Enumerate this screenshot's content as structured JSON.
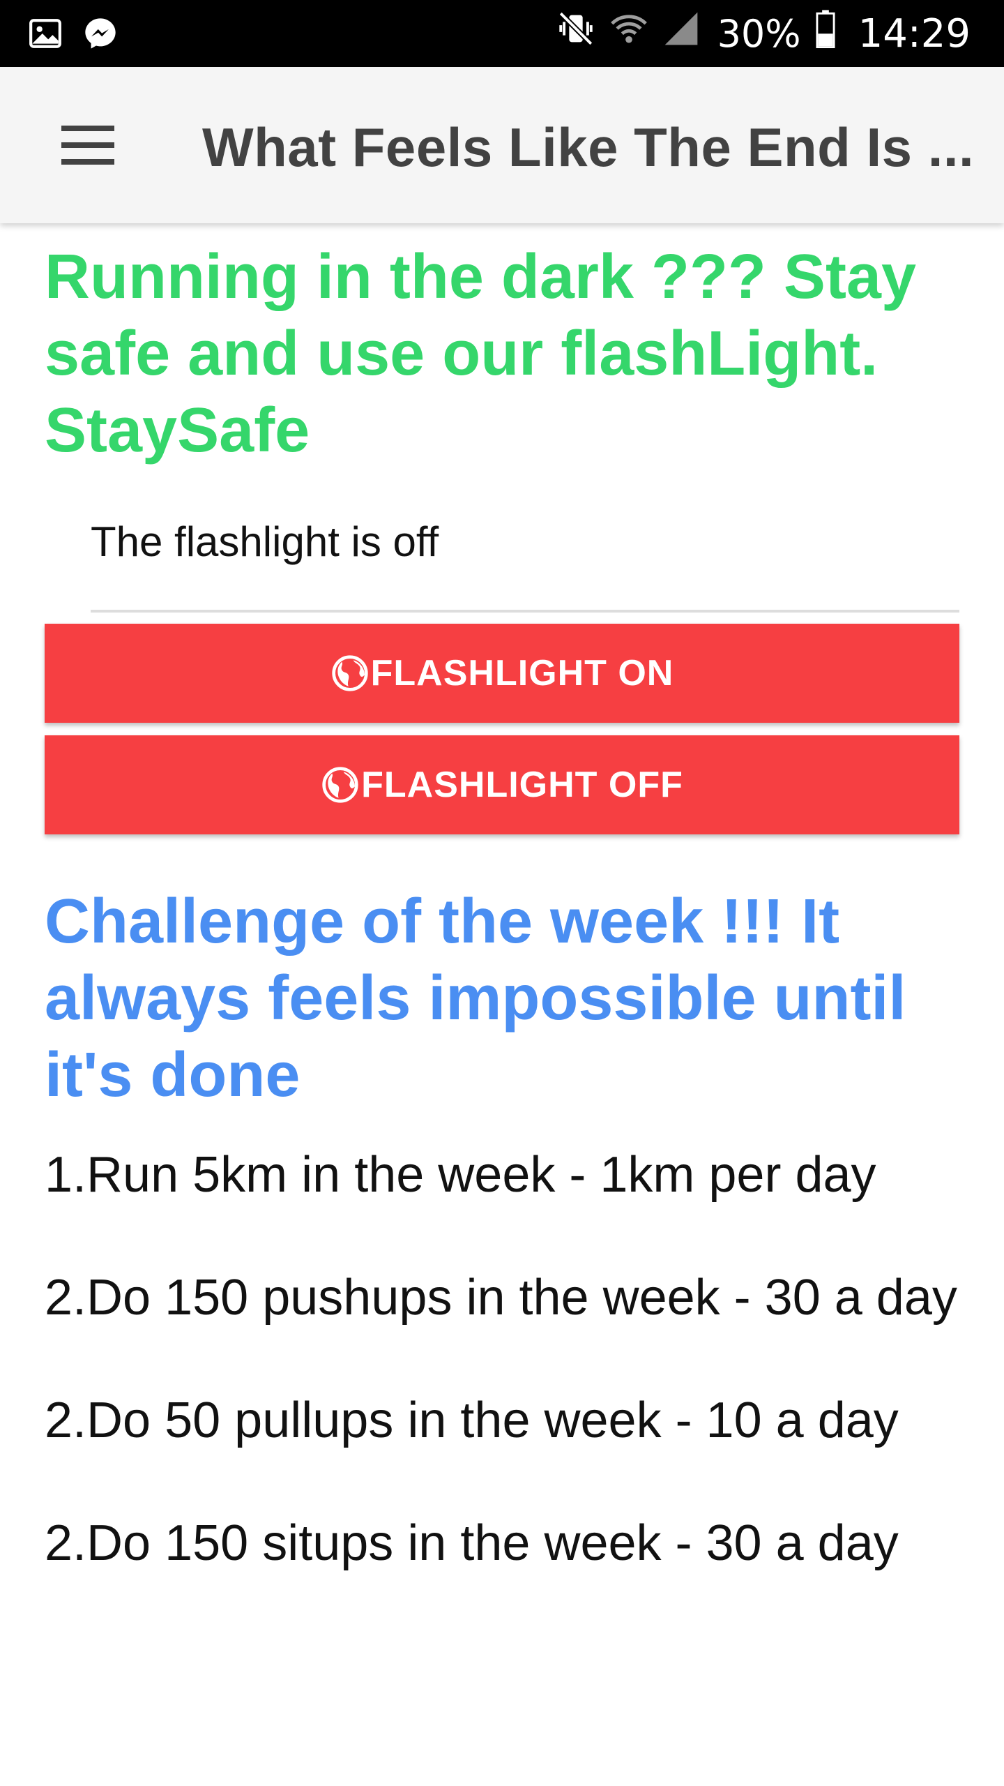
{
  "status_bar": {
    "left_icons": [
      "image-icon",
      "messenger-icon"
    ],
    "right_icons": [
      "mute-vibrate-icon",
      "wifi-icon",
      "signal-icon",
      "battery-icon"
    ],
    "battery": "30%",
    "time": "14:29"
  },
  "app_bar": {
    "title": "What Feels Like The End Is ...",
    "menu_icon": "hamburger-menu-icon"
  },
  "content": {
    "flash_heading": "Running in the dark ??? Stay safe and use our flashLight. StaySafe",
    "flashlight_status": "The flashlight is off",
    "buttons": {
      "on_label": "FLASHLIGHT ON",
      "off_label": "FLASHLIGHT OFF",
      "icon": "globe-icon"
    },
    "challenge_heading": "Challenge of the week !!! It always feels impossible until it's done",
    "challenges": [
      "1.Run 5km in the week - 1km per day",
      "2.Do 150 pushups in the week - 30 a day",
      "2.Do 50 pullups in the week - 10 a day",
      "2.Do 150 situps in the week - 30 a day"
    ]
  },
  "colors": {
    "green_heading": "#35d66b",
    "blue_heading": "#4a8ef2",
    "button_red": "#f63f42",
    "app_bar_bg": "#f5f5f5",
    "status_bar_bg": "#000000"
  }
}
